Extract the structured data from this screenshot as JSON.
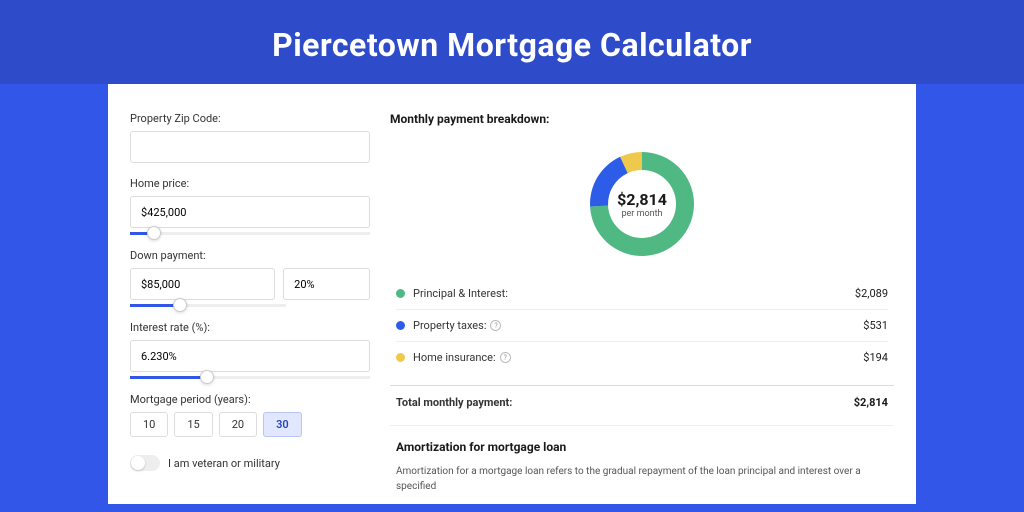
{
  "header": {
    "title": "Piercetown Mortgage Calculator"
  },
  "form": {
    "zip_label": "Property Zip Code:",
    "zip_value": "",
    "price_label": "Home price:",
    "price_value": "$425,000",
    "down_label": "Down payment:",
    "down_amount": "$85,000",
    "down_pct": "20%",
    "rate_label": "Interest rate (%):",
    "rate_value": "6.230%",
    "period_label": "Mortgage period (years):",
    "periods": [
      "10",
      "15",
      "20",
      "30"
    ],
    "period_active": 3,
    "veteran_label": "I am veteran or military"
  },
  "breakdown": {
    "title": "Monthly payment breakdown:",
    "center_amount": "$2,814",
    "center_sub": "per month",
    "items": [
      {
        "label": "Principal & Interest:",
        "value": "$2,089",
        "color": "#4fb883",
        "num": 2089,
        "info": false
      },
      {
        "label": "Property taxes:",
        "value": "$531",
        "color": "#2d5de8",
        "num": 531,
        "info": true
      },
      {
        "label": "Home insurance:",
        "value": "$194",
        "color": "#efc94c",
        "num": 194,
        "info": true
      }
    ],
    "total_label": "Total monthly payment:",
    "total_value": "$2,814"
  },
  "amort": {
    "title": "Amortization for mortgage loan",
    "text": "Amortization for a mortgage loan refers to the gradual repayment of the loan principal and interest over a specified"
  },
  "chart_data": {
    "type": "pie",
    "title": "Monthly payment breakdown",
    "series": [
      {
        "name": "Principal & Interest",
        "value": 2089,
        "color": "#4fb883"
      },
      {
        "name": "Property taxes",
        "value": 531,
        "color": "#2d5de8"
      },
      {
        "name": "Home insurance",
        "value": 194,
        "color": "#efc94c"
      }
    ],
    "total": 2814
  }
}
